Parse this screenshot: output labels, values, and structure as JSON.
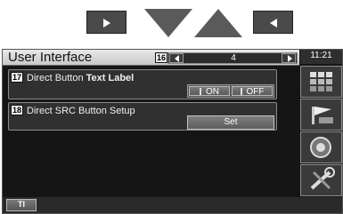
{
  "top_nav": {
    "icons": [
      "play-right-icon",
      "down-triangle-icon",
      "up-triangle-icon",
      "back-left-icon"
    ]
  },
  "header": {
    "title": "User Interface",
    "page_badge": "16",
    "page_number": "4",
    "clock": "11:21"
  },
  "rows": [
    {
      "badge": "17",
      "label_prefix": "Direct Button ",
      "label_bold": "Text Label",
      "on_label": "ON",
      "off_label": "OFF"
    },
    {
      "badge": "18",
      "label": "Direct SRC Button Setup",
      "button_label": "Set"
    }
  ],
  "sidebar": {
    "icons": [
      "grid-menu-icon",
      "flag-setup-icon",
      "speaker-audio-icon",
      "wrench-settings-icon"
    ]
  },
  "footer": {
    "ti_label": "TI"
  }
}
